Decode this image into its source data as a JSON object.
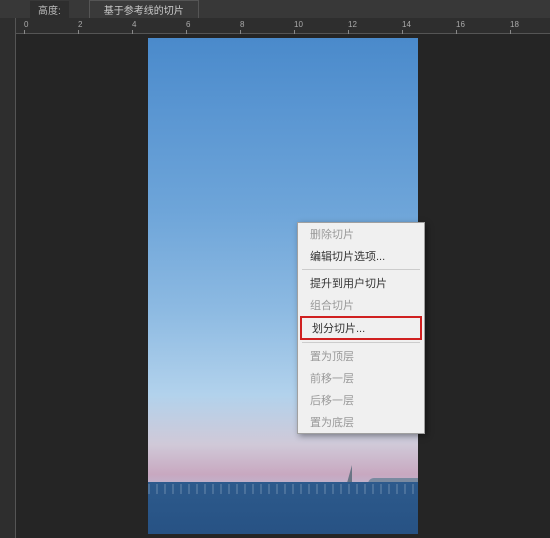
{
  "toolbar": {
    "label1": "高度:",
    "button1": "基于参考线的切片"
  },
  "ruler": {
    "ticks": [
      "0",
      "2",
      "4",
      "6",
      "8",
      "10",
      "12",
      "14",
      "16",
      "18"
    ]
  },
  "context_menu": {
    "items": [
      {
        "label": "删除切片",
        "disabled": true
      },
      {
        "label": "编辑切片选项...",
        "disabled": false
      },
      {
        "sep": true
      },
      {
        "label": "提升到用户切片",
        "disabled": false
      },
      {
        "label": "组合切片",
        "disabled": true
      },
      {
        "label": "划分切片...",
        "disabled": false,
        "highlighted": true
      },
      {
        "sep": true
      },
      {
        "label": "置为顶层",
        "disabled": true
      },
      {
        "label": "前移一层",
        "disabled": true
      },
      {
        "label": "后移一层",
        "disabled": true
      },
      {
        "label": "置为底层",
        "disabled": true
      }
    ]
  }
}
